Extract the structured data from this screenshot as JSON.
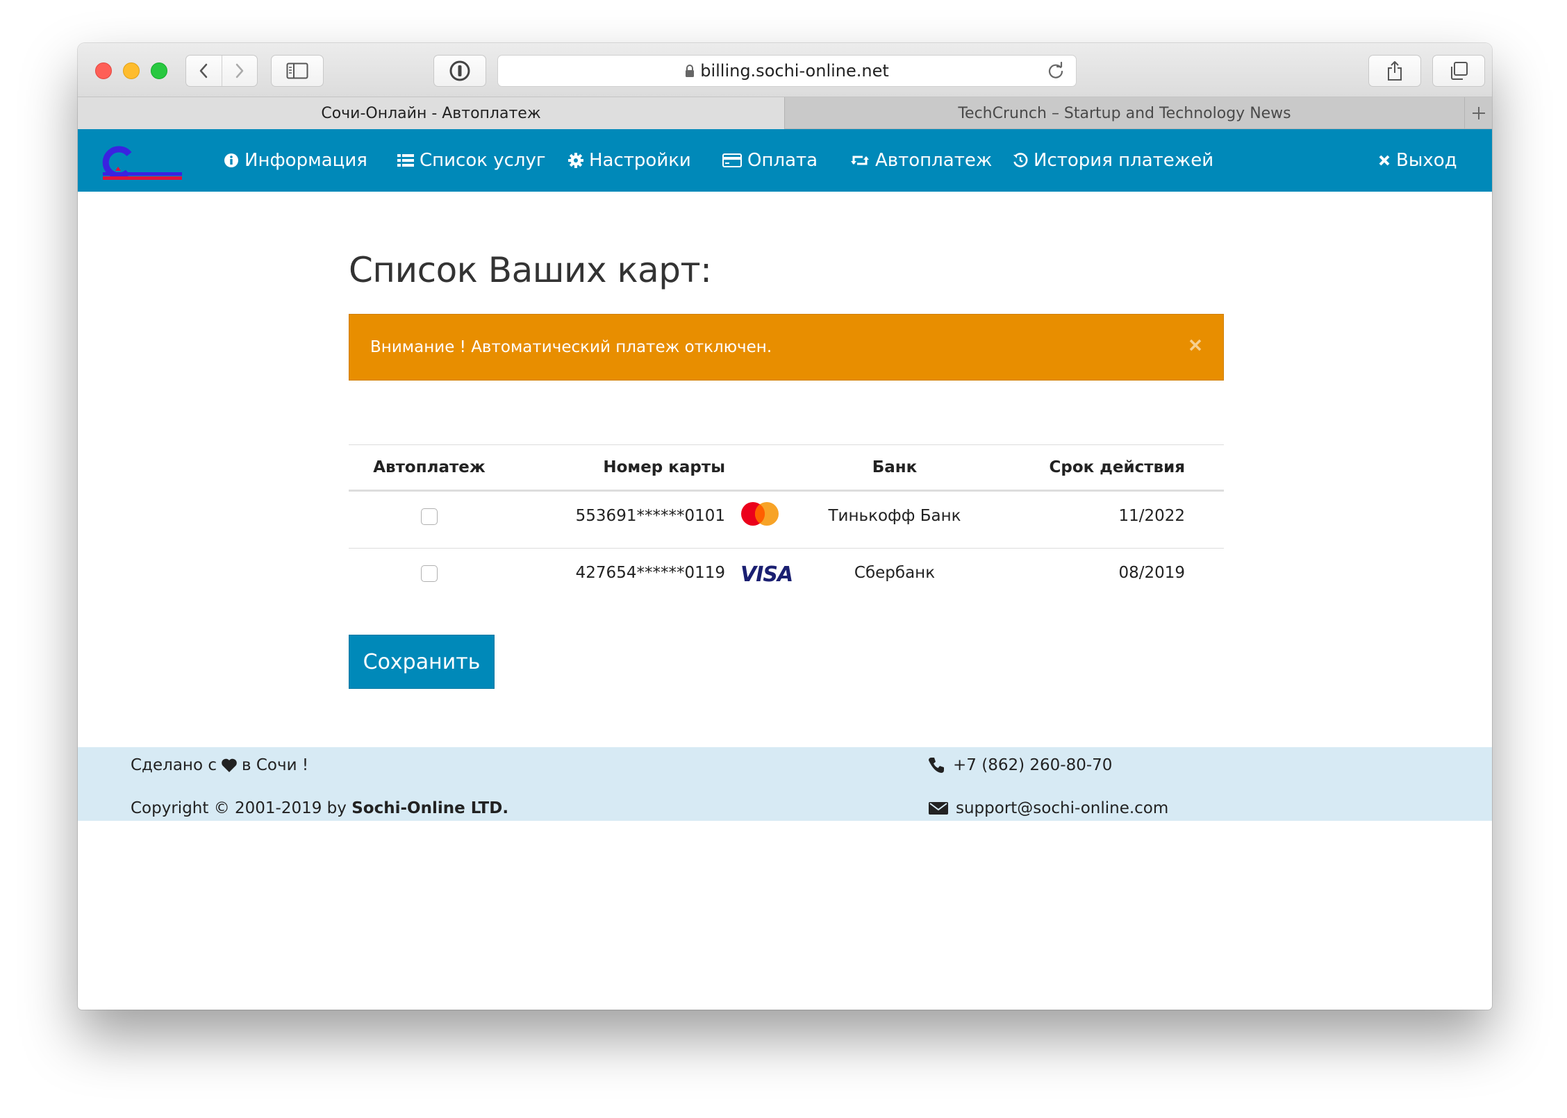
{
  "browser": {
    "url": "billing.sochi-online.net",
    "tabs": [
      {
        "label": "Сочи-Онлайн - Автоплатеж",
        "active": true
      },
      {
        "label": "TechCrunch – Startup and Technology News",
        "active": false
      }
    ]
  },
  "nav": {
    "items": [
      {
        "label": "Информация",
        "icon": "info-circle-icon"
      },
      {
        "label": "Список услуг",
        "icon": "list-icon"
      },
      {
        "label": "Настройки",
        "icon": "gear-icon"
      },
      {
        "label": "Оплата",
        "icon": "credit-card-icon"
      },
      {
        "label": "Автоплатеж",
        "icon": "retweet-icon"
      },
      {
        "label": "История платежей",
        "icon": "history-icon"
      }
    ],
    "logout": "Выход"
  },
  "page": {
    "title": "Список Ваших карт:",
    "alert": "Внимание ! Автоматический платеж отключен."
  },
  "table": {
    "headers": {
      "autopay": "Автоплатеж",
      "number": "Номер карты",
      "bank": "Банк",
      "expiry": "Срок действия"
    },
    "rows": [
      {
        "autopay": false,
        "number": "553691******0101",
        "brand": "mastercard",
        "bank": "Тинькофф Банк",
        "expiry": "11/2022"
      },
      {
        "autopay": false,
        "number": "427654******0119",
        "brand": "visa",
        "bank": "Сбербанк",
        "expiry": "08/2019"
      }
    ]
  },
  "visa_text": "VISA",
  "save_label": "Сохранить",
  "footer": {
    "made_prefix": "Сделано с",
    "made_suffix": "в Сочи !",
    "copyright_prefix": "Copyright © 2001-2019 by ",
    "copyright_company": "Sochi-Online LTD.",
    "phone": "+7 (862) 260-80-70",
    "email": "support@sochi-online.com"
  },
  "colors": {
    "brand": "#0089b9",
    "alert": "#e88e00",
    "footer_bg": "#d7eaf4",
    "mastercard_red": "#eb001b",
    "mastercard_orange": "#f79e1b",
    "visa_blue": "#1a1f71"
  }
}
